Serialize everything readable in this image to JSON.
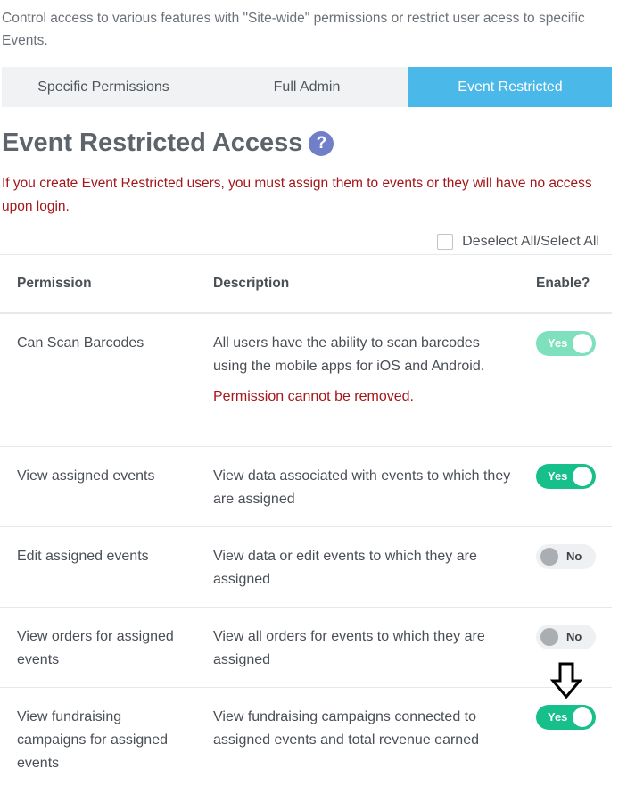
{
  "intro": "Control access to various features with \"Site-wide\" permissions or restrict user acess to specific Events.",
  "tabs": [
    {
      "label": "Specific Permissions"
    },
    {
      "label": "Full Admin"
    },
    {
      "label": "Event Restricted"
    }
  ],
  "heading": "Event Restricted Access",
  "help_glyph": "?",
  "warning": "If you create Event Restricted users, you must assign them to events or they will have no access upon login.",
  "select_all_label": "Deselect All/Select All",
  "table": {
    "headers": {
      "permission": "Permission",
      "description": "Description",
      "enable": "Enable?"
    },
    "rows": [
      {
        "permission": "Can Scan Barcodes",
        "description": "All users have the ability to scan barcodes using the mobile apps for iOS and Android.",
        "note": "Permission cannot be removed.",
        "toggle": "Yes"
      },
      {
        "permission": "View assigned events",
        "description": "View data associated with events to which they are assigned",
        "toggle": "Yes"
      },
      {
        "permission": "Edit assigned events",
        "description": "View data or edit events to which they are assigned",
        "toggle": "No"
      },
      {
        "permission": "View orders for assigned events",
        "description": "View all orders for events to which they are assigned",
        "toggle": "No"
      },
      {
        "permission": "View fundraising campaigns for assigned events",
        "description": "View fundraising campaigns connected to assigned events and total revenue earned",
        "toggle": "Yes"
      }
    ]
  },
  "colors": {
    "accent_tab": "#4ab8e8",
    "toggle_on": "#17c08a",
    "warning": "#a3161a"
  },
  "icons": {
    "help": "question-circle-icon",
    "annotation": "arrow-down-icon"
  }
}
